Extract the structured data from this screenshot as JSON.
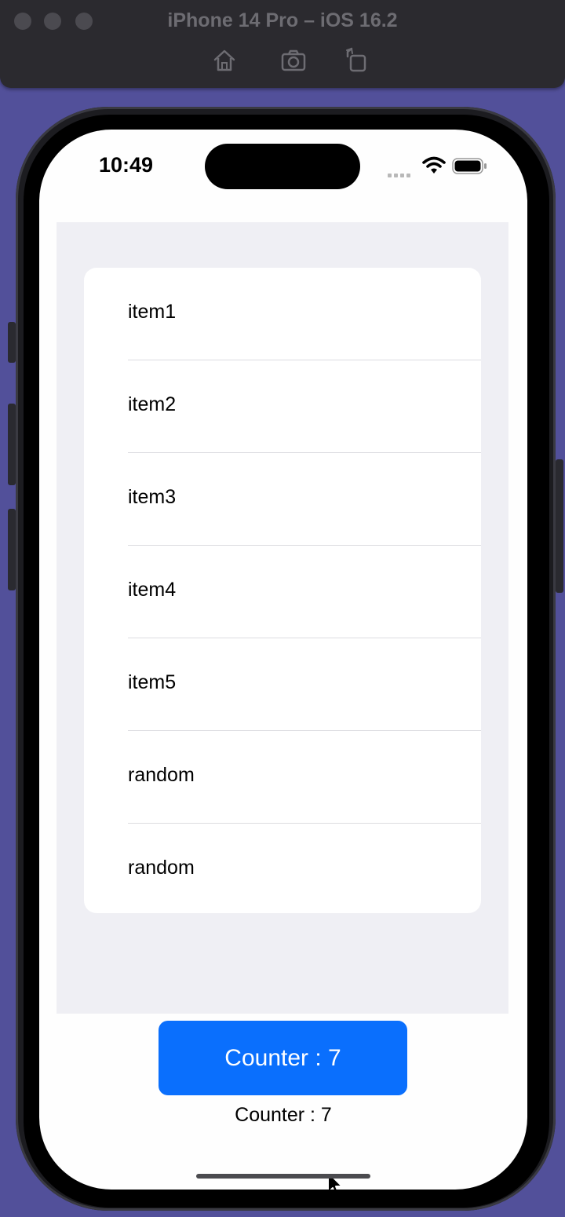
{
  "window": {
    "title": "iPhone 14 Pro – iOS 16.2",
    "toolbar_icons": [
      "home-icon",
      "screenshot-icon",
      "rotate-icon"
    ]
  },
  "status_bar": {
    "time": "10:49",
    "icons": [
      "cellular-signal-icon",
      "wifi-icon",
      "battery-icon"
    ]
  },
  "list": {
    "items": [
      {
        "label": "item1"
      },
      {
        "label": "item2"
      },
      {
        "label": "item3"
      },
      {
        "label": "item4"
      },
      {
        "label": "item5"
      },
      {
        "label": "random"
      },
      {
        "label": "random"
      }
    ]
  },
  "counter_button": {
    "label": "Counter : 7"
  },
  "counter_text": "Counter : 7",
  "colors": {
    "accent": "#0a6ffd",
    "desktop_bg": "#52509a",
    "list_background": "#efeff4"
  }
}
